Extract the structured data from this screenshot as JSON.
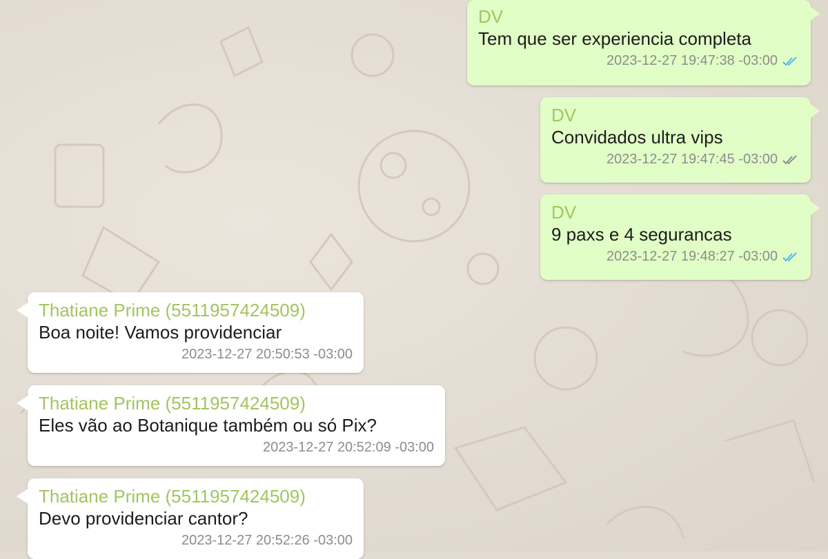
{
  "chat": {
    "messages": [
      {
        "direction": "outgoing",
        "sender": "DV",
        "text": "Tem que ser experiencia completa",
        "timestamp": "2023-12-27 19:47:38 -03:00",
        "status": "read",
        "status_icon": "double-check-blue-icon"
      },
      {
        "direction": "outgoing",
        "sender": "DV",
        "text": "Convidados ultra vips",
        "timestamp": "2023-12-27 19:47:45 -03:00",
        "status": "delivered",
        "status_icon": "double-check-gray-icon"
      },
      {
        "direction": "outgoing",
        "sender": "DV",
        "text": "9 paxs e 4 segurancas",
        "timestamp": "2023-12-27 19:48:27 -03:00",
        "status": "read",
        "status_icon": "double-check-blue-icon"
      },
      {
        "direction": "incoming",
        "sender": "Thatiane Prime (5511957424509)",
        "text": "Boa noite! Vamos providenciar",
        "timestamp": "2023-12-27 20:50:53 -03:00"
      },
      {
        "direction": "incoming",
        "sender": "Thatiane Prime (5511957424509)",
        "text": "Eles vão ao Botanique também ou só Pix?",
        "timestamp": "2023-12-27 20:52:09 -03:00"
      },
      {
        "direction": "incoming",
        "sender": "Thatiane Prime (5511957424509)",
        "text": "Devo providenciar cantor?",
        "timestamp": "2023-12-27 20:52:26 -03:00"
      }
    ]
  },
  "colors": {
    "outgoing_bubble": "#e1fec6",
    "incoming_bubble": "#ffffff",
    "sender_name": "#a3c45f",
    "read_ticks": "#4fb6ec",
    "delivered_ticks": "#8c8c8c",
    "chat_background": "#e3dcd2"
  }
}
